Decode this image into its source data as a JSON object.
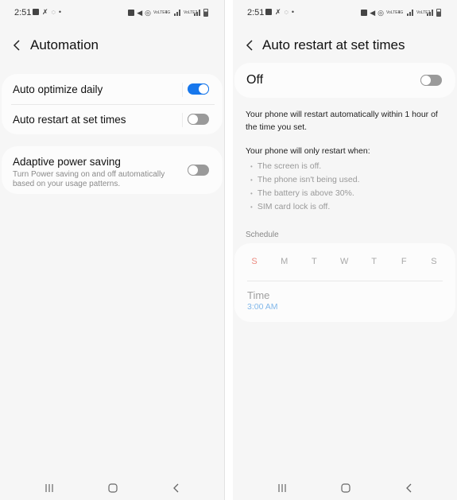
{
  "status_bar": {
    "time": "2:51",
    "left_icons": [
      "gallery-icon",
      "missed-call-icon",
      "whatsapp-icon",
      "dot-icon"
    ],
    "right_icons": [
      "alarm-icon",
      "mute-icon",
      "hotspot-icon",
      "volte-lte1-icon",
      "4g-icon",
      "signal-icon",
      "volte-lte2-icon",
      "signal-icon",
      "battery-icon"
    ],
    "volte1": "VoLTE1",
    "volte2": "VoLTE2",
    "net": "4G"
  },
  "left_screen": {
    "title": "Automation",
    "items": [
      {
        "label": "Auto optimize daily",
        "toggle": "on"
      },
      {
        "label": "Auto restart at set times",
        "toggle": "off"
      }
    ],
    "adaptive": {
      "label": "Adaptive power saving",
      "description": "Turn Power saving on and off automatically based on your usage patterns.",
      "toggle": "off"
    }
  },
  "right_screen": {
    "title": "Auto restart at set times",
    "master": {
      "label": "Off",
      "toggle": "off"
    },
    "desc1": "Your phone will restart automatically within 1 hour of the time you set.",
    "desc2": "Your phone will only restart when:",
    "conditions": [
      "The screen is off.",
      "The phone isn't being used.",
      "The battery is above 30%.",
      "SIM card lock is off."
    ],
    "schedule_header": "Schedule",
    "days": [
      "S",
      "M",
      "T",
      "W",
      "T",
      "F",
      "S"
    ],
    "time_label": "Time",
    "time_value": "3:00 AM"
  },
  "nav_bar": [
    "recents-icon",
    "home-icon",
    "back-icon"
  ],
  "colors": {
    "accent": "#1777ec",
    "sunday": "#ec8b80",
    "time_value": "#82b8ea",
    "background": "#f6f6f6",
    "card": "#fcfcfc"
  }
}
